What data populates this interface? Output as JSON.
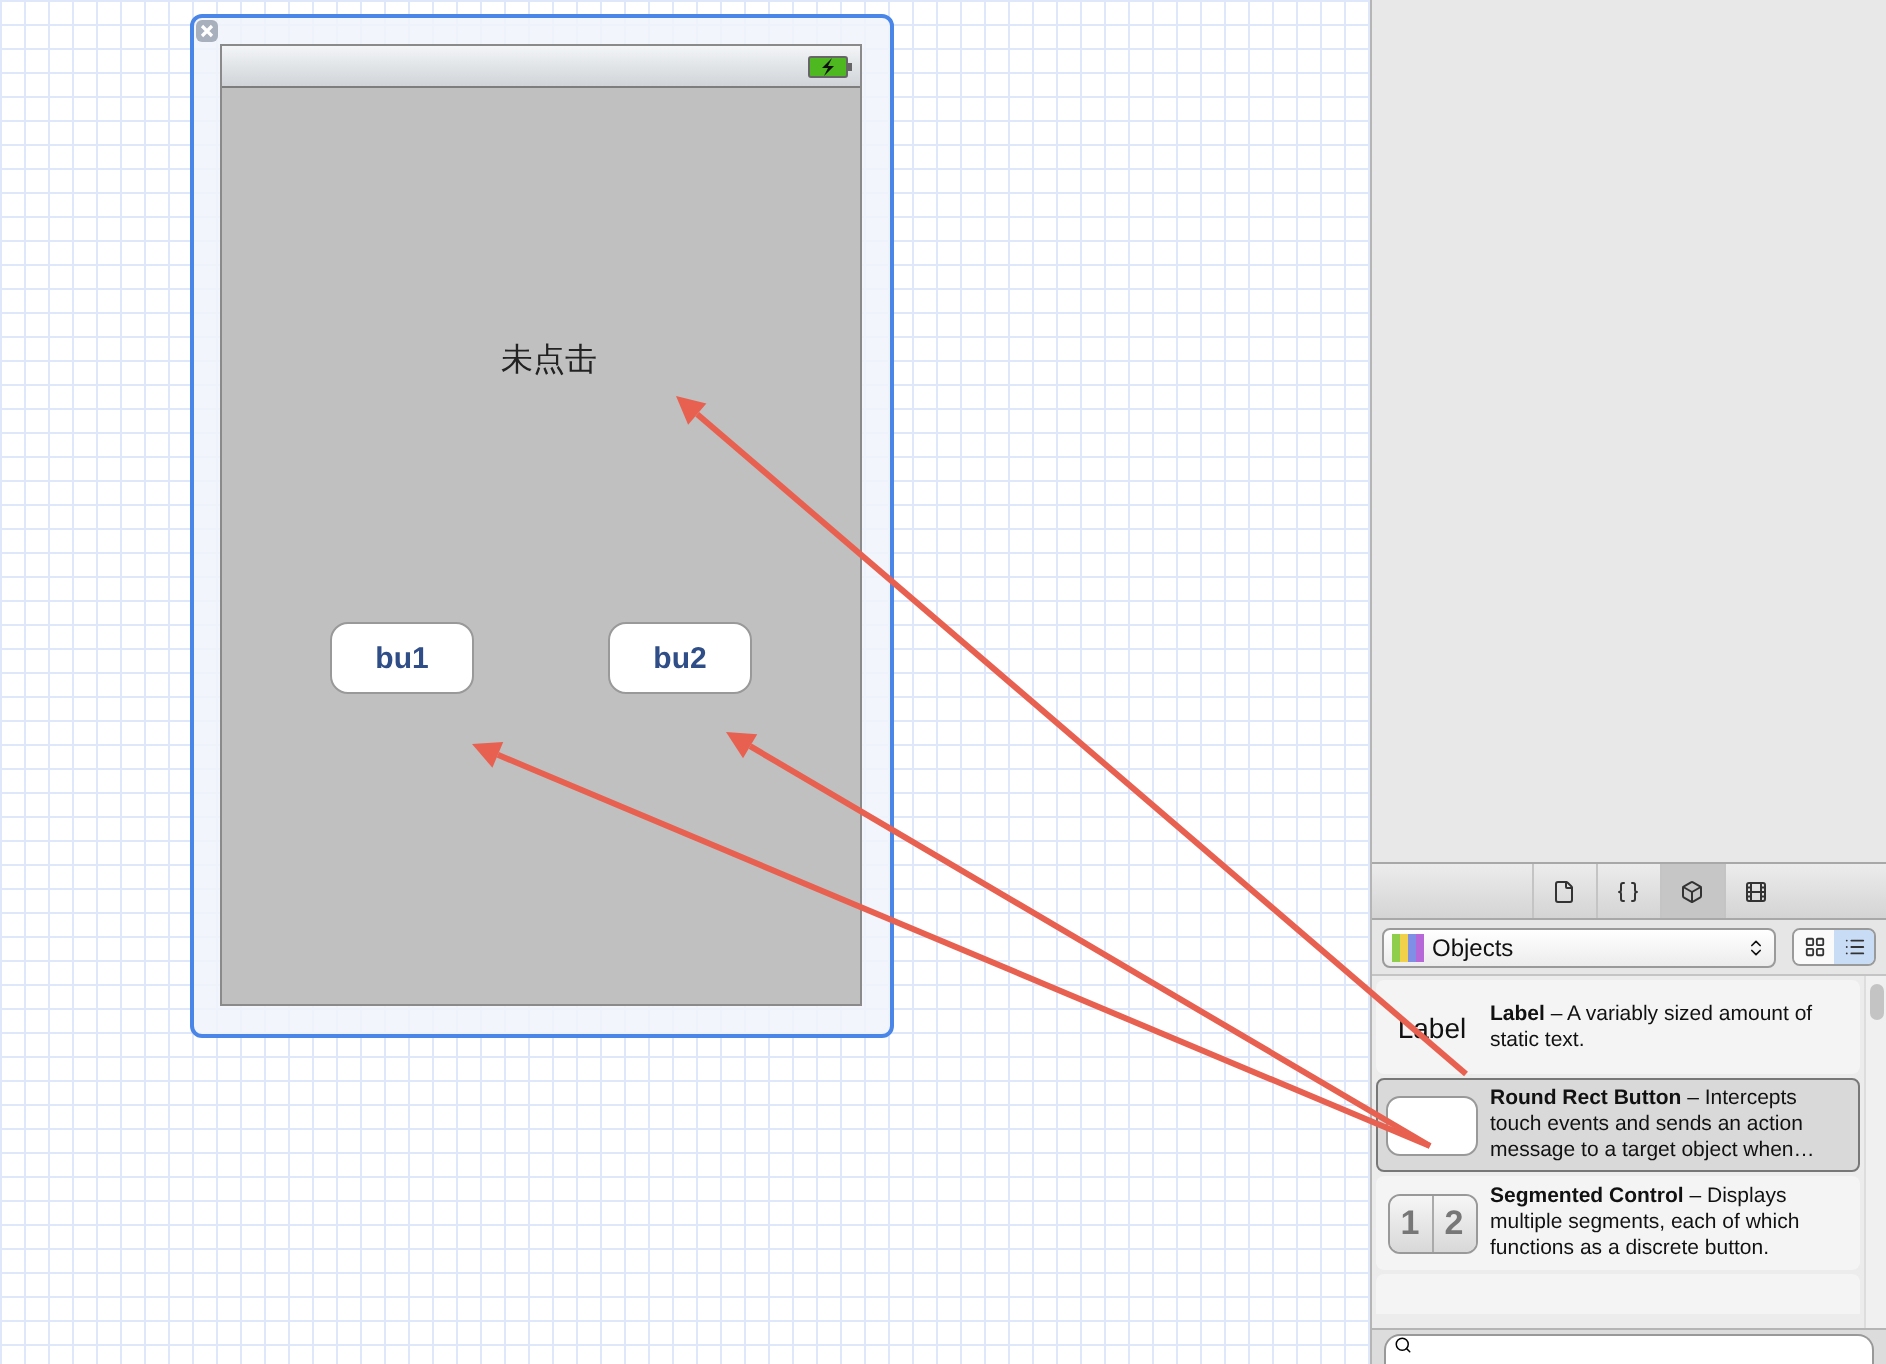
{
  "canvas": {
    "view": {
      "label": "未点击",
      "buttons": [
        {
          "label": "bu1"
        },
        {
          "label": "bu2"
        }
      ]
    }
  },
  "library": {
    "tabs": [
      {
        "kind": "file",
        "selected": false
      },
      {
        "kind": "braces",
        "selected": false
      },
      {
        "kind": "cube",
        "selected": true
      },
      {
        "kind": "film",
        "selected": false
      }
    ],
    "picker": {
      "value": "Objects"
    },
    "view_modes": [
      {
        "kind": "grid",
        "selected": false
      },
      {
        "kind": "list",
        "selected": true
      }
    ],
    "items": [
      {
        "kind": "label",
        "preview": "Label",
        "description": "**Label** – A variably sized amount of static text.",
        "selected": false
      },
      {
        "kind": "button",
        "description": "**Round Rect Button** – Intercepts touch events and sends an action message to a target object when…",
        "selected": true
      },
      {
        "kind": "segmented",
        "segments": [
          "1",
          "2"
        ],
        "description": "**Segmented Control** – Displays multiple segments, each of which functions as a discrete button.",
        "selected": false
      }
    ]
  }
}
